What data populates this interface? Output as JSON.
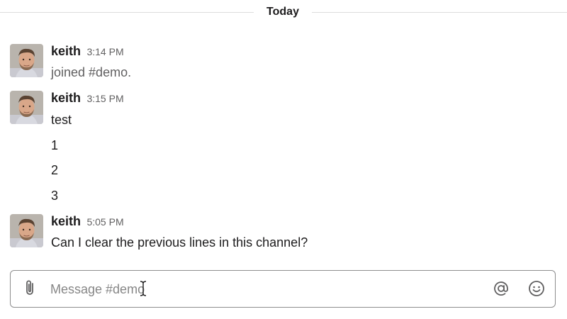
{
  "divider": {
    "label": "Today"
  },
  "messages": [
    {
      "author": "keith",
      "time": "3:14 PM",
      "lines": [
        "joined #demo."
      ]
    },
    {
      "author": "keith",
      "time": "3:15 PM",
      "lines": [
        "test",
        "1",
        "2",
        "3"
      ]
    },
    {
      "author": "keith",
      "time": "5:05 PM",
      "lines": [
        "Can I clear the previous lines in this channel?"
      ]
    }
  ],
  "composer": {
    "placeholder": "Message #demo",
    "value": ""
  },
  "icons": {
    "attach": "paperclip-icon",
    "mention": "at-sign-icon",
    "emoji": "smiley-icon",
    "cursor": "text-cursor-icon"
  },
  "colors": {
    "text": "#1d1c1d",
    "muted_text": "#616061",
    "divider": "#dddddd",
    "composer_border": "#8d8d8e",
    "placeholder": "#868686"
  }
}
